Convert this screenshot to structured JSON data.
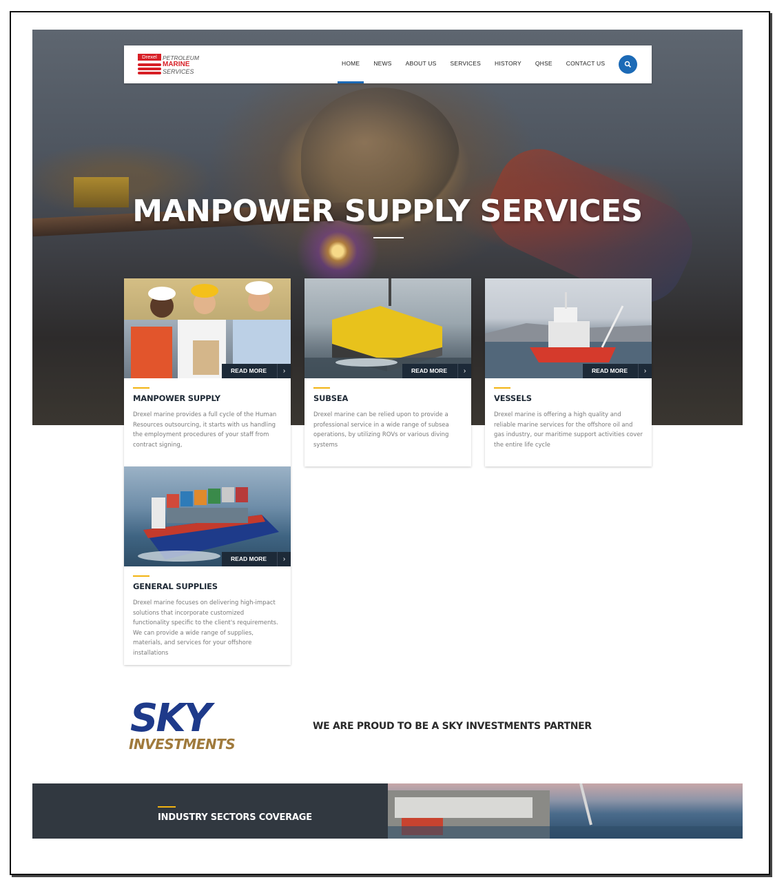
{
  "nav": {
    "logo": {
      "tag": "Drexel",
      "line1": "PETROLEUM",
      "line2": "MARINE",
      "line3": "SERVICES"
    },
    "items": [
      {
        "label": "HOME",
        "active": true
      },
      {
        "label": "NEWS"
      },
      {
        "label": "ABOUT US"
      },
      {
        "label": "SERVICES"
      },
      {
        "label": "HISTORY"
      },
      {
        "label": "QHSE"
      },
      {
        "label": "CONTACT US"
      }
    ],
    "search_icon": "search-icon",
    "accent_color": "#1c6ab6"
  },
  "hero": {
    "title": "MANPOWER SUPPLY SERVICES"
  },
  "cards": [
    {
      "title": "MANPOWER SUPPLY",
      "read_more": "READ MORE",
      "description": "Drexel marine provides a full cycle of the Human Resources outsourcing, it starts with us handling the employment procedures of your staff from contract signing,"
    },
    {
      "title": "SUBSEA",
      "read_more": "READ MORE",
      "description": "Drexel marine can be relied upon to provide a professional service in a wide range of subsea operations, by utilizing ROVs or various diving systems"
    },
    {
      "title": "VESSELS",
      "read_more": "READ MORE",
      "description": "Drexel marine is offering a high quality and reliable marine services for the offshore oil and gas industry, our maritime support activities cover the entire life cycle"
    },
    {
      "title": "GENERAL SUPPLIES",
      "read_more": "READ MORE",
      "description": "Drexel marine focuses on delivering high-impact solutions that incorporate customized functionality specific to the client's requirements. We can provide a wide range of supplies, materials, and services for your offshore installations"
    }
  ],
  "partner": {
    "logo_top": "SKY",
    "logo_bottom": "INVESTMENTS",
    "text": "WE ARE PROUD TO BE A SKY INVESTMENTS PARTNER"
  },
  "bottom": {
    "title": "INDUSTRY SECTORS COVERAGE"
  },
  "colors": {
    "accent_yellow": "#f2b311",
    "dark_navy": "#1d2a38",
    "brand_red": "#d71f26",
    "sky_blue": "#1e3a8a",
    "sky_gold": "#a07a3c"
  }
}
